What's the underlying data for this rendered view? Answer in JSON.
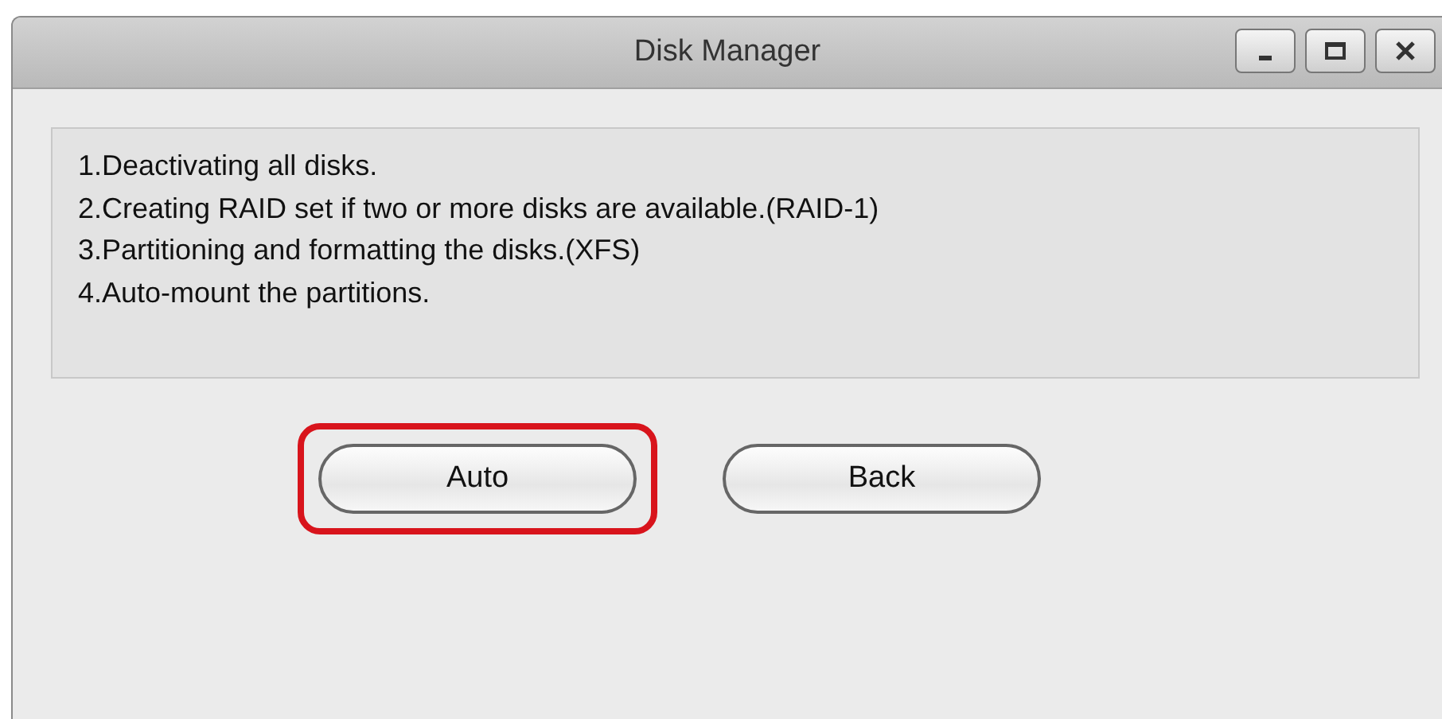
{
  "window": {
    "title": "Disk Manager"
  },
  "steps": [
    "1.Deactivating all disks.",
    "2.Creating RAID set if two or more disks are available.(RAID-1)",
    "3.Partitioning and formatting the disks.(XFS)",
    "4.Auto-mount the partitions."
  ],
  "buttons": [
    {
      "label": "Auto",
      "highlighted": true
    },
    {
      "label": "Back",
      "highlighted": false
    }
  ]
}
